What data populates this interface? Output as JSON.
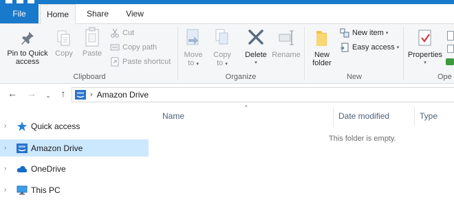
{
  "ribbon_tabs": {
    "file": "File",
    "home": "Home",
    "share": "Share",
    "view": "View"
  },
  "clipboard": {
    "pin_line1": "Pin to Quick",
    "pin_line2": "access",
    "copy": "Copy",
    "paste": "Paste",
    "cut": "Cut",
    "copy_path": "Copy path",
    "paste_shortcut": "Paste shortcut",
    "label": "Clipboard"
  },
  "organize": {
    "move_line1": "Move",
    "move_line2": "to",
    "copy_line1": "Copy",
    "copy_line2": "to",
    "delete": "Delete",
    "rename": "Rename",
    "label": "Organize"
  },
  "new_group": {
    "new_folder_line1": "New",
    "new_folder_line2": "folder",
    "new_item": "New item",
    "easy_access": "Easy access",
    "label": "New"
  },
  "open_group": {
    "properties": "Properties",
    "label_partial": "Ope"
  },
  "address": {
    "crumb": "Amazon Drive"
  },
  "nav_pane": {
    "items": [
      {
        "label": "Quick access",
        "icon": "star-icon"
      },
      {
        "label": "Amazon Drive",
        "icon": "amazon-drive-icon",
        "selected": true
      },
      {
        "label": "OneDrive",
        "icon": "cloud-icon"
      },
      {
        "label": "This PC",
        "icon": "monitor-icon"
      }
    ]
  },
  "content": {
    "columns": [
      "Name",
      "Date modified",
      "Type"
    ],
    "empty_message": "This folder is empty."
  },
  "colors": {
    "accent": "#1979ca",
    "selection": "#cce8ff",
    "ribbon_bg": "#f5f6f7"
  }
}
